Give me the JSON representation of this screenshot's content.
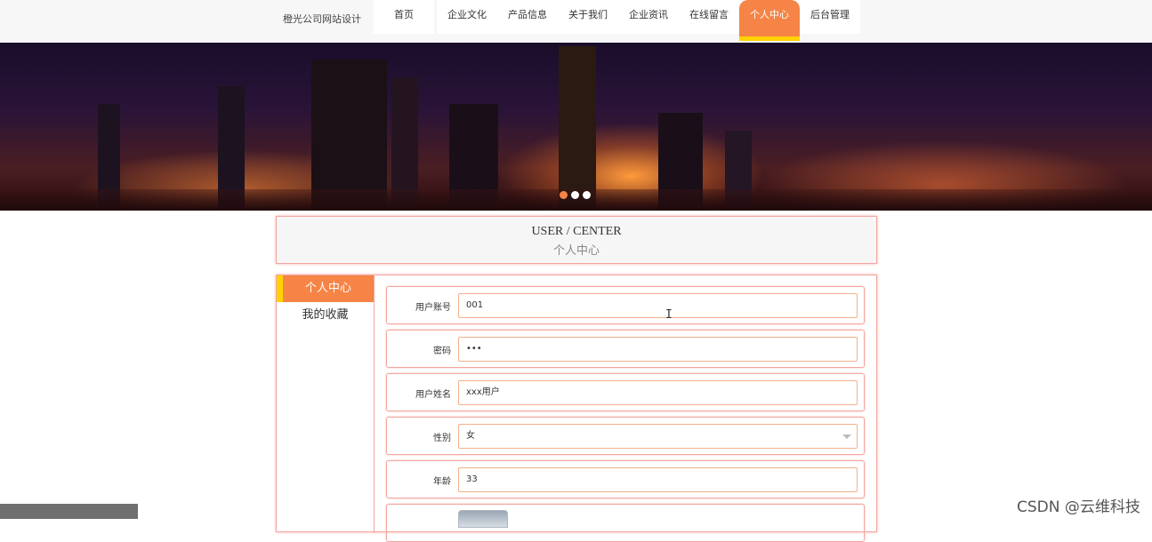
{
  "header": {
    "brand": "橙光公司网站设计",
    "nav": [
      "首页",
      "企业文化",
      "产品信息",
      "关于我们",
      "企业资讯",
      "在线留言",
      "个人中心",
      "后台管理"
    ],
    "active_nav": "个人中心"
  },
  "banner": {
    "slide_count": 3,
    "active_slide": 1
  },
  "user_center": {
    "title_en": "USER / CENTER",
    "title_cn": "个人中心"
  },
  "sidebar": {
    "items": [
      "个人中心",
      "我的收藏"
    ]
  },
  "form": {
    "account_label": "用户账号",
    "account_value": "001",
    "password_label": "密码",
    "password_value": "•••",
    "name_label": "用户姓名",
    "name_value": "xxx用户",
    "gender_label": "性别",
    "gender_value": "女",
    "age_label": "年龄",
    "age_value": "33"
  },
  "watermark": "CSDN @云维科技",
  "colors": {
    "accent": "#f58446",
    "highlight": "#ffd200",
    "border": "#f3a6a0"
  }
}
